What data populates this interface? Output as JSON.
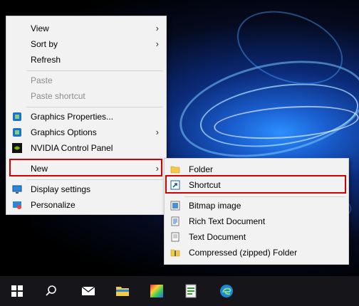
{
  "context_menu": {
    "items": [
      {
        "label": "View",
        "submenu": true
      },
      {
        "label": "Sort by",
        "submenu": true
      },
      {
        "label": "Refresh"
      },
      {
        "label": "Paste",
        "disabled": true
      },
      {
        "label": "Paste shortcut",
        "disabled": true
      },
      {
        "label": "Graphics Properties...",
        "icon": "intel-graphics-icon"
      },
      {
        "label": "Graphics Options",
        "icon": "intel-graphics-icon",
        "submenu": true
      },
      {
        "label": "NVIDIA Control Panel",
        "icon": "nvidia-icon"
      },
      {
        "label": "New",
        "submenu": true,
        "highlighted": true
      },
      {
        "label": "Display settings",
        "icon": "display-icon"
      },
      {
        "label": "Personalize",
        "icon": "personalize-icon"
      }
    ]
  },
  "new_submenu": {
    "items": [
      {
        "label": "Folder",
        "icon": "folder-icon"
      },
      {
        "label": "Shortcut",
        "icon": "shortcut-icon",
        "highlighted": true
      },
      {
        "label": "Bitmap image",
        "icon": "bitmap-icon"
      },
      {
        "label": "Rich Text Document",
        "icon": "rtf-icon"
      },
      {
        "label": "Text Document",
        "icon": "text-document-icon"
      },
      {
        "label": "Compressed (zipped) Folder",
        "icon": "zip-folder-icon"
      }
    ]
  },
  "taskbar": {
    "items": [
      "windows-start-icon",
      "search-icon",
      "mail-icon",
      "file-explorer-icon",
      "color-app-icon",
      "notepad-app-icon",
      "edge-icon"
    ]
  },
  "colors": {
    "highlight_border": "#d40000",
    "menu_bg": "#f2f2f2",
    "taskbar_bg": "#15151a"
  }
}
